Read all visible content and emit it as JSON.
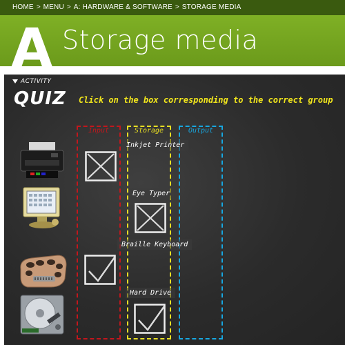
{
  "breadcrumb": {
    "items": [
      "HOME",
      "MENU",
      "A: HARDWARE & SOFTWARE",
      "STORAGE MEDIA"
    ],
    "separator": ">"
  },
  "header": {
    "letter": "A",
    "title": "Storage media"
  },
  "activity": {
    "label": "ACTIVITY",
    "heading": "QUIZ",
    "instruction": "Click on the box corresponding to the correct group"
  },
  "columns": {
    "input": "Input",
    "storage": "Storage",
    "output": "Output"
  },
  "colors": {
    "topbar": "#3a5a0f",
    "header_green": "#7fb025",
    "input": "#c4161c",
    "storage": "#e9df23",
    "output": "#17a7e0",
    "instruction": "#f2e61c"
  },
  "items": [
    {
      "name": "Inkjet Printer",
      "icon": "inkjet-printer-image",
      "input_box": "x-mark",
      "storage_box": null
    },
    {
      "name": "Eye Typer",
      "icon": "eye-typer-image",
      "input_box": null,
      "storage_box": "x-mark"
    },
    {
      "name": "Braille Keyboard",
      "icon": "braille-keyboard-image",
      "input_box": "check-mark",
      "storage_box": null
    },
    {
      "name": "Hard Drive",
      "icon": "hard-drive-image",
      "input_box": null,
      "storage_box": "check-mark"
    }
  ]
}
